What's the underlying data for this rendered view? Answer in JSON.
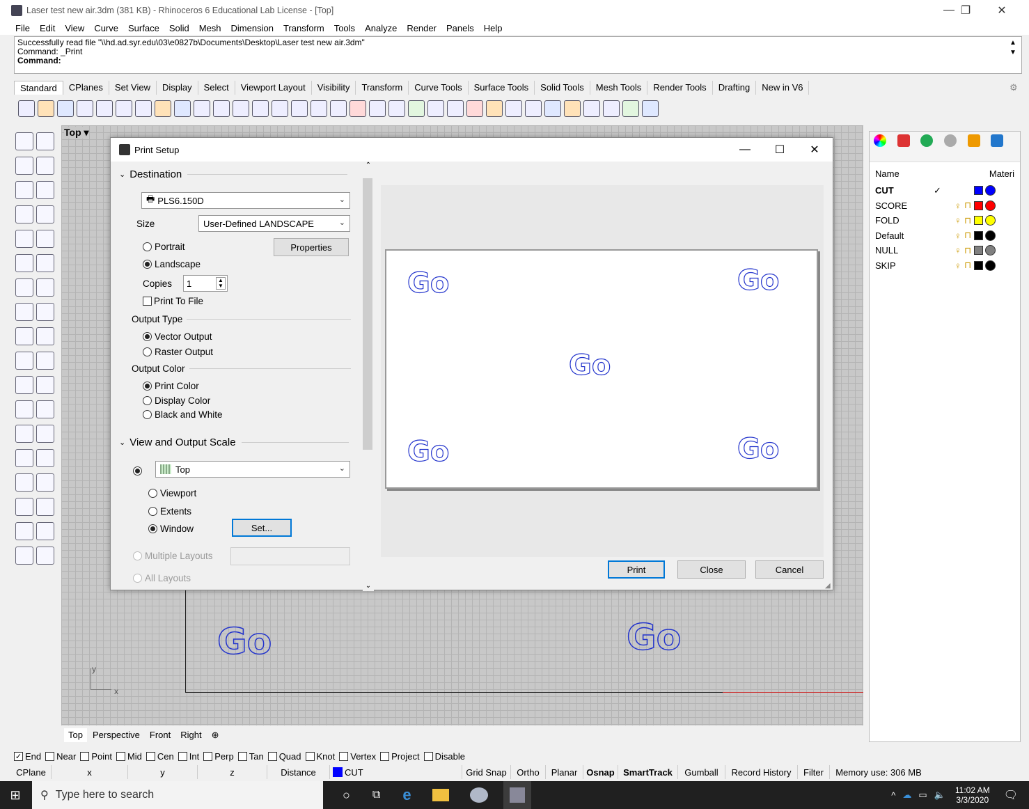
{
  "window": {
    "title": "Laser test new air.3dm (381 KB) - Rhinoceros 6 Educational Lab License - [Top]"
  },
  "menu": [
    "File",
    "Edit",
    "View",
    "Curve",
    "Surface",
    "Solid",
    "Mesh",
    "Dimension",
    "Transform",
    "Tools",
    "Analyze",
    "Render",
    "Panels",
    "Help"
  ],
  "command": {
    "history": [
      "Successfully read file \"\\\\hd.ad.syr.edu\\03\\e0827b\\Documents\\Desktop\\Laser test new air.3dm\"",
      "Command: _Print"
    ],
    "prompt": "Command:"
  },
  "toolbar_tabs": [
    "Standard",
    "CPlanes",
    "Set View",
    "Display",
    "Select",
    "Viewport Layout",
    "Visibility",
    "Transform",
    "Curve Tools",
    "Surface Tools",
    "Solid Tools",
    "Mesh Tools",
    "Render Tools",
    "Drafting",
    "New in V6"
  ],
  "viewport": {
    "label": "Top",
    "go_text": "Go",
    "tabs": [
      "Top",
      "Perspective",
      "Front",
      "Right"
    ],
    "axis_x": "x",
    "axis_y": "y"
  },
  "layers": {
    "col_name": "Name",
    "col_material": "Materi",
    "items": [
      {
        "name": "CUT",
        "color": "#0000ff",
        "current": true
      },
      {
        "name": "SCORE",
        "color": "#ff0000",
        "current": false
      },
      {
        "name": "FOLD",
        "color": "#ffff00",
        "current": false
      },
      {
        "name": "Default",
        "color": "#000000",
        "current": false
      },
      {
        "name": "NULL",
        "color": "#808080",
        "current": false
      },
      {
        "name": "SKIP",
        "color": "#000000",
        "current": false
      }
    ]
  },
  "osnaps": [
    {
      "label": "End",
      "checked": true
    },
    {
      "label": "Near",
      "checked": false
    },
    {
      "label": "Point",
      "checked": false
    },
    {
      "label": "Mid",
      "checked": false
    },
    {
      "label": "Cen",
      "checked": false
    },
    {
      "label": "Int",
      "checked": false
    },
    {
      "label": "Perp",
      "checked": false
    },
    {
      "label": "Tan",
      "checked": false
    },
    {
      "label": "Quad",
      "checked": false
    },
    {
      "label": "Knot",
      "checked": false
    },
    {
      "label": "Vertex",
      "checked": false
    },
    {
      "label": "Project",
      "checked": false
    },
    {
      "label": "Disable",
      "checked": false
    }
  ],
  "status": {
    "cplane": "CPlane",
    "x": "x",
    "y": "y",
    "z": "z",
    "distance": "Distance",
    "layer": "CUT",
    "grid_snap": "Grid Snap",
    "ortho": "Ortho",
    "planar": "Planar",
    "osnap": "Osnap",
    "smarttrack": "SmartTrack",
    "gumball": "Gumball",
    "record_history": "Record History",
    "filter": "Filter",
    "memory": "Memory use: 306 MB"
  },
  "taskbar": {
    "search_placeholder": "Type here to search",
    "time": "11:02 AM",
    "date": "3/3/2020"
  },
  "dialog": {
    "title": "Print Setup",
    "destination": {
      "heading": "Destination",
      "printer": "PLS6.150D",
      "size_label": "Size",
      "size_value": "User-Defined LANDSCAPE",
      "portrait": "Portrait",
      "landscape": "Landscape",
      "properties_button": "Properties",
      "copies_label": "Copies",
      "copies_value": "1",
      "print_to_file": "Print To File"
    },
    "output_type": {
      "heading": "Output Type",
      "vector": "Vector Output",
      "raster": "Raster Output"
    },
    "output_color": {
      "heading": "Output Color",
      "print": "Print Color",
      "display": "Display Color",
      "bw": "Black and White"
    },
    "view_scale": {
      "heading": "View and Output Scale",
      "view": "Top",
      "viewport": "Viewport",
      "extents": "Extents",
      "window": "Window",
      "set_button": "Set...",
      "multiple_layouts": "Multiple Layouts",
      "all_layouts": "All Layouts"
    },
    "buttons": {
      "print": "Print",
      "close": "Close",
      "cancel": "Cancel"
    },
    "preview_text": "Go"
  }
}
